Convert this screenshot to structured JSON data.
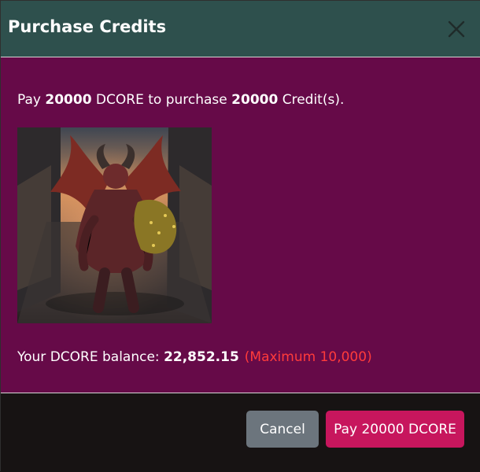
{
  "dialog": {
    "title": "Purchase Credits",
    "close_icon": "close-icon",
    "message": {
      "prefix": "Pay ",
      "amount": "20000",
      "currency": " DCORE to purchase ",
      "credits": "20000",
      "suffix": " Credit(s)."
    },
    "image": {
      "description": "winged-demon-artwork"
    },
    "balance": {
      "label": "Your DCORE balance: ",
      "value": "22,852.15",
      "limit": "(Maximum 10,000)",
      "limit_color": "#ff3b3b"
    },
    "buttons": {
      "cancel": "Cancel",
      "pay": "Pay 20000 DCORE"
    }
  },
  "colors": {
    "header": "#2e504d",
    "body": "#660a48",
    "footer": "#171313",
    "cancel": "#6c757d",
    "pay": "#c7165d"
  }
}
